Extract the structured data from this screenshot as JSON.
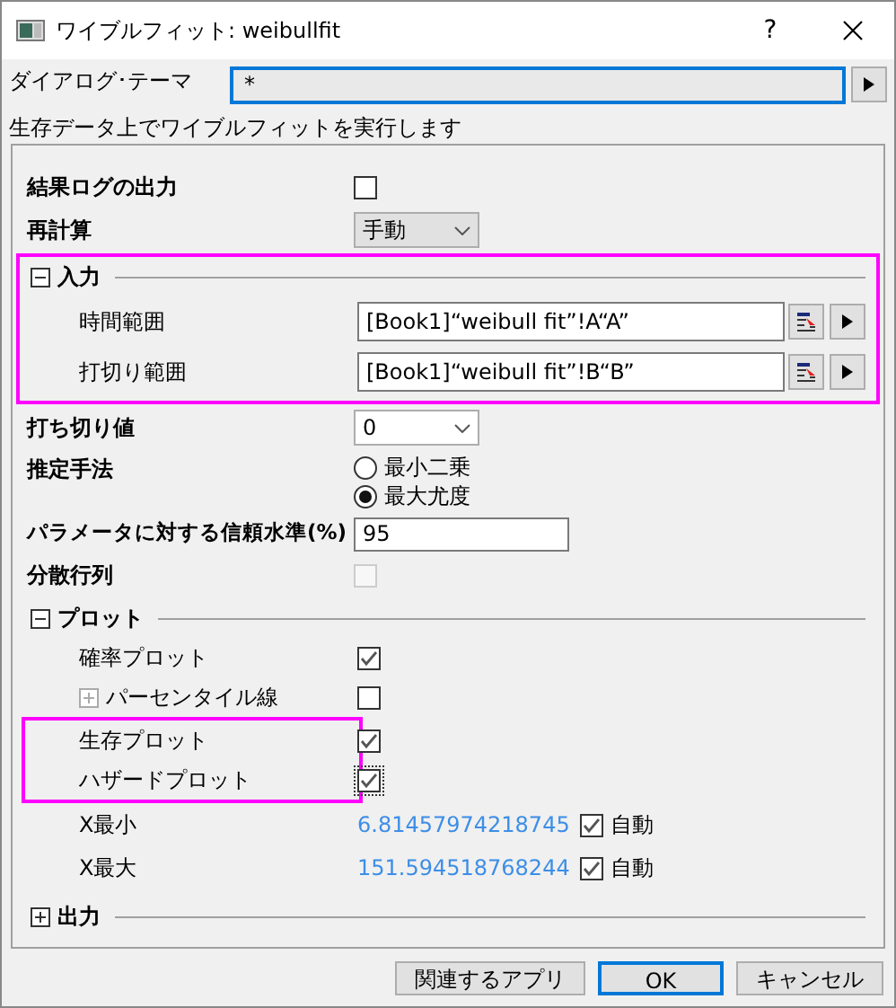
{
  "window": {
    "title": "ワイブルフィット: weibullfit",
    "help": "?"
  },
  "theme": {
    "label": "ダイアログ･テーマ",
    "value": "*"
  },
  "description": "生存データ上でワイブルフィットを実行します",
  "panel": [
    {
      "kind": "checkbox",
      "label": "結果ログの出力",
      "checked": false,
      "disabled": false
    },
    {
      "kind": "combo",
      "label": "再計算",
      "value": "手動"
    },
    {
      "kind": "section",
      "label": "入力",
      "expanded": true,
      "highlighted": true,
      "items": [
        {
          "kind": "range",
          "label": "時間範囲",
          "value": "[Book1]“weibull fit”!A“A”"
        },
        {
          "kind": "range",
          "label": "打切り範囲",
          "value": "[Book1]“weibull fit”!B“B”"
        }
      ]
    },
    {
      "kind": "dropdown",
      "label": "打ち切り値",
      "value": "0"
    },
    {
      "kind": "radio",
      "label": "推定手法",
      "options": [
        {
          "label": "最小二乗",
          "selected": false
        },
        {
          "label": "最大尤度",
          "selected": true
        }
      ]
    },
    {
      "kind": "text",
      "label": "パラメータに対する信頼水準(%)",
      "value": "95"
    },
    {
      "kind": "checkbox",
      "label": "分散行列",
      "checked": false,
      "disabled": true
    },
    {
      "kind": "section",
      "label": "プロット",
      "expanded": true,
      "highlighted": false,
      "items": [
        {
          "kind": "checkbox",
          "label": "確率プロット",
          "checked": true,
          "disabled": false
        },
        {
          "kind": "checkbox",
          "label": "パーセンタイル線",
          "checked": false,
          "disabled": false,
          "expanded": false
        },
        {
          "kind": "group",
          "highlighted": true,
          "items": [
            {
              "kind": "checkbox",
              "label": "生存プロット",
              "checked": true,
              "disabled": false
            },
            {
              "kind": "checkbox",
              "label": "ハザードプロット",
              "checked": true,
              "disabled": false,
              "focused": true
            }
          ]
        },
        {
          "kind": "auto",
          "label": "X最小",
          "value": "6.81457974218745",
          "auto_label": "自動",
          "checked": true
        },
        {
          "kind": "auto",
          "label": "X最大",
          "value": "151.594518768244",
          "auto_label": "自動",
          "checked": true
        }
      ]
    },
    {
      "kind": "section",
      "label": "出力",
      "expanded": false,
      "highlighted": false
    }
  ],
  "buttons": [
    {
      "label": "関連するアプリ",
      "default": false
    },
    {
      "label": "OK",
      "default": true
    },
    {
      "label": "キャンセル",
      "default": false
    }
  ]
}
